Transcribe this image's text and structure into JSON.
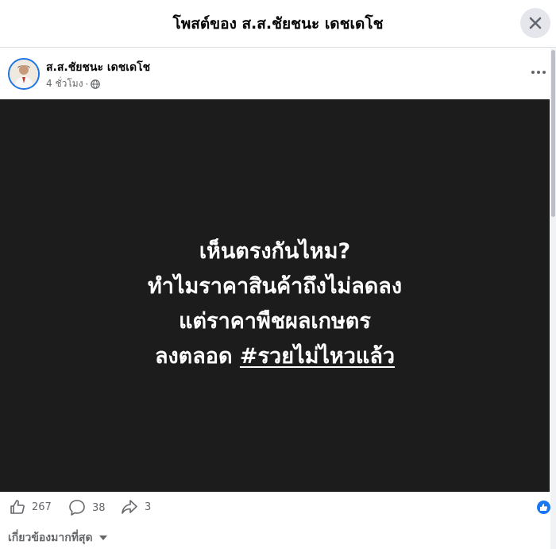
{
  "header": {
    "title": "โพสต์ของ ส.ส.ชัยชนะ เดชเดโช"
  },
  "author": {
    "name": "ส.ส.ชัยชนะ เดชเดโช",
    "time": "4 ชั่วโมง",
    "audience_icon": "globe-icon"
  },
  "post": {
    "line1": "เห็นตรงกันไหม?",
    "line2": "ทำไมราคาสินค้าถึงไม่ลดลง",
    "line3": "แต่ราคาพืชผลเกษตร",
    "line4_text": "ลงตลอด",
    "line4_hashtag": "#รวยไม่ไหวแล้ว",
    "background": "#1c1c1c",
    "text_color": "#ffffff"
  },
  "actions": {
    "likes": "267",
    "comments": "38",
    "shares": "3"
  },
  "comments": {
    "sort_label": "เกี่ยวข้องมากที่สุด"
  },
  "colors": {
    "accent": "#1877f2",
    "secondary_text": "#65676b"
  }
}
